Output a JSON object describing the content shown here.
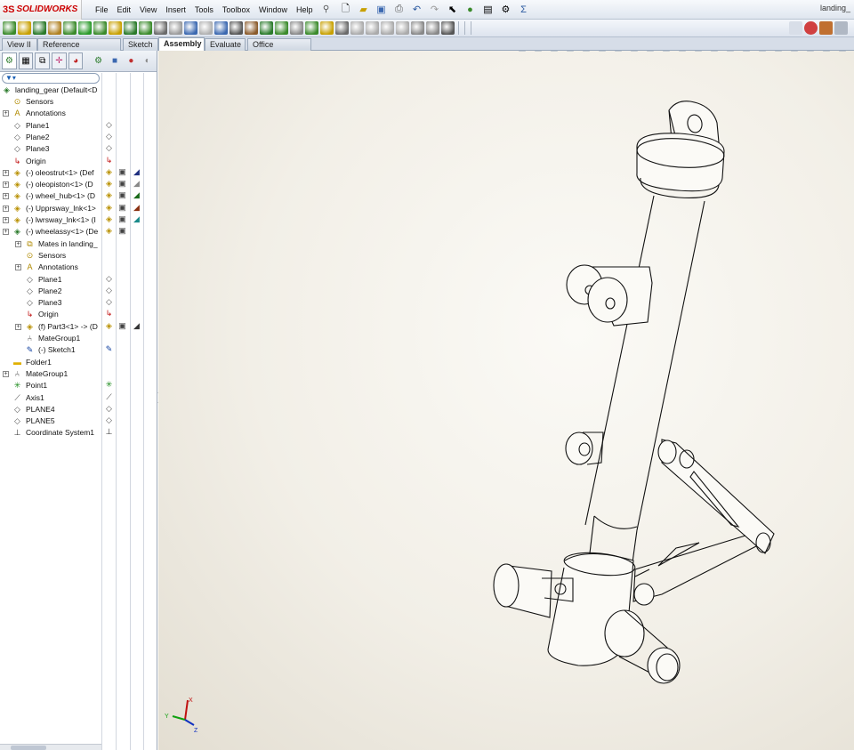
{
  "app": {
    "logo": "SOLIDWORKS",
    "logo_prefix": "3S",
    "document_title": "landing_"
  },
  "menu": [
    "File",
    "Edit",
    "View",
    "Insert",
    "Tools",
    "Toolbox",
    "Window",
    "Help"
  ],
  "tabs": [
    {
      "label": "View II",
      "active": false
    },
    {
      "label": "Reference Geometry",
      "active": false
    },
    {
      "label": "Sketch",
      "active": false
    },
    {
      "label": "Assembly",
      "active": true
    },
    {
      "label": "Evaluate",
      "active": false
    },
    {
      "label": "Office Products",
      "active": false
    }
  ],
  "feature_tree": {
    "root": "landing_gear  (Default<D",
    "items": [
      {
        "label": "Sensors",
        "icon": "sensor-icon"
      },
      {
        "label": "Annotations",
        "icon": "annotations-icon",
        "expandable": true
      },
      {
        "label": "Plane1",
        "icon": "plane-icon"
      },
      {
        "label": "Plane2",
        "icon": "plane-icon"
      },
      {
        "label": "Plane3",
        "icon": "plane-icon"
      },
      {
        "label": "Origin",
        "icon": "origin-icon"
      },
      {
        "label": "(-) oleostrut<1> (Def",
        "icon": "part-icon",
        "expandable": true
      },
      {
        "label": "(-) oleopiston<1> (D",
        "icon": "part-icon",
        "expandable": true
      },
      {
        "label": "(-) wheel_hub<1> (D",
        "icon": "part-icon",
        "expandable": true
      },
      {
        "label": "(-) Upprsway_lnk<1>",
        "icon": "part-icon",
        "expandable": true
      },
      {
        "label": "(-) lwrsway_lnk<1> (I",
        "icon": "part-icon",
        "expandable": true
      },
      {
        "label": "(-) wheelassy<1> (De",
        "icon": "subassembly-icon",
        "expandable": true,
        "expanded": true
      },
      {
        "label": "Mates in landing_",
        "icon": "mates-icon",
        "indent": 1,
        "expandable": true
      },
      {
        "label": "Sensors",
        "icon": "sensor-icon",
        "indent": 1
      },
      {
        "label": "Annotations",
        "icon": "annotations-icon",
        "indent": 1,
        "expandable": true
      },
      {
        "label": "Plane1",
        "icon": "plane-icon",
        "indent": 1
      },
      {
        "label": "Plane2",
        "icon": "plane-icon",
        "indent": 1
      },
      {
        "label": "Plane3",
        "icon": "plane-icon",
        "indent": 1
      },
      {
        "label": "Origin",
        "icon": "origin-icon",
        "indent": 1
      },
      {
        "label": "(f) Part3<1> -> (D",
        "icon": "part-icon",
        "indent": 1,
        "expandable": true
      },
      {
        "label": "MateGroup1",
        "icon": "mategroup-icon",
        "indent": 1
      },
      {
        "label": "(-) Sketch1",
        "icon": "sketch-icon",
        "indent": 1
      },
      {
        "label": "Folder1",
        "icon": "folder-icon"
      },
      {
        "label": "MateGroup1",
        "icon": "mategroup-icon",
        "expandable": true
      },
      {
        "label": "Point1",
        "icon": "point-icon"
      },
      {
        "label": "Axis1",
        "icon": "axis-icon"
      },
      {
        "label": "PLANE4",
        "icon": "plane-icon"
      },
      {
        "label": "PLANE5",
        "icon": "plane-icon"
      },
      {
        "label": "Coordinate System1",
        "icon": "coordinate-system-icon"
      }
    ]
  },
  "triad": {
    "x": "X",
    "y": "Y",
    "z": "Z"
  },
  "colors": {
    "accent": "#c00000",
    "tab_active": "#ffffff",
    "viewport": "#f2efe7",
    "line": "#111111"
  }
}
